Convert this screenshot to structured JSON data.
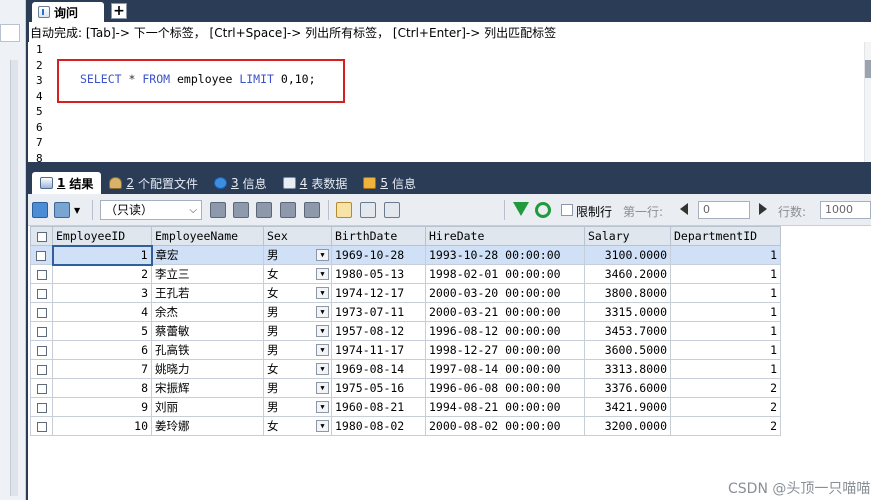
{
  "tabs": {
    "query_label": "询问",
    "add_label": "+"
  },
  "hint": "自动完成: [Tab]-> 下一个标签， [Ctrl+Space]-> 列出所有标签， [Ctrl+Enter]-> 列出匹配标签",
  "editor": {
    "line_numbers": [
      "1",
      "2",
      "3",
      "4",
      "5",
      "6",
      "7",
      "8"
    ],
    "sql": {
      "kw_select": "SELECT",
      "star": "*",
      "kw_from": "FROM",
      "table": "employee",
      "kw_limit": "LIMIT",
      "args": "0,10;"
    }
  },
  "result_tabs": [
    {
      "num": "1",
      "label": "结果"
    },
    {
      "num": "2",
      "label": "个配置文件"
    },
    {
      "num": "3",
      "label": "信息"
    },
    {
      "num": "4",
      "label": "表数据"
    },
    {
      "num": "5",
      "label": "信息"
    }
  ],
  "toolbar": {
    "mode_select": "（只读）",
    "limit_label": "限制行",
    "first_row_label": "第一行:",
    "first_row_value": "0",
    "rows_label": "行数:",
    "rows_value": "1000"
  },
  "columns": [
    "EmployeeID",
    "EmployeeName",
    "Sex",
    "BirthDate",
    "HireDate",
    "Salary",
    "DepartmentID"
  ],
  "rows": [
    [
      "1",
      "章宏",
      "男",
      "1969-10-28",
      "1993-10-28 00:00:00",
      "3100.0000",
      "1"
    ],
    [
      "2",
      "李立三",
      "女",
      "1980-05-13",
      "1998-02-01 00:00:00",
      "3460.2000",
      "1"
    ],
    [
      "3",
      "王孔若",
      "女",
      "1974-12-17",
      "2000-03-20 00:00:00",
      "3800.8000",
      "1"
    ],
    [
      "4",
      "余杰",
      "男",
      "1973-07-11",
      "2000-03-21 00:00:00",
      "3315.0000",
      "1"
    ],
    [
      "5",
      "蔡蕾敏",
      "男",
      "1957-08-12",
      "1996-08-12 00:00:00",
      "3453.7000",
      "1"
    ],
    [
      "6",
      "孔高铁",
      "男",
      "1974-11-17",
      "1998-12-27 00:00:00",
      "3600.5000",
      "1"
    ],
    [
      "7",
      "姚晓力",
      "女",
      "1969-08-14",
      "1997-08-14 00:00:00",
      "3313.8000",
      "1"
    ],
    [
      "8",
      "宋振辉",
      "男",
      "1975-05-16",
      "1996-06-08 00:00:00",
      "3376.6000",
      "2"
    ],
    [
      "9",
      "刘丽",
      "男",
      "1960-08-21",
      "1994-08-21 00:00:00",
      "3421.9000",
      "2"
    ],
    [
      "10",
      "姜玲娜",
      "女",
      "1980-08-02",
      "2000-08-02 00:00:00",
      "3200.0000",
      "2"
    ]
  ],
  "watermark": "CSDN @头顶一只喵喵",
  "colors": {
    "dark_frame": "#2b3c57",
    "highlight_box": "#d62020",
    "sql_keyword": "#3b53c9"
  }
}
